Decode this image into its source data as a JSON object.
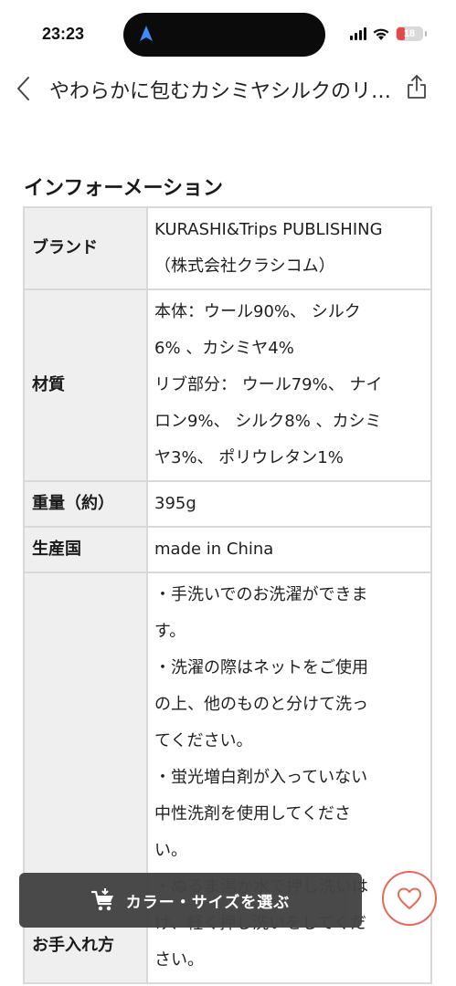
{
  "status_bar": {
    "time": "23:23",
    "battery_level": "18"
  },
  "header": {
    "title": "やわらかに包むカシミヤシルクのリブ編みニット",
    "back_icon": "chevron-left-icon",
    "share_icon": "share-icon"
  },
  "section": {
    "title": "インフォーメーション"
  },
  "info_table": {
    "brand_label": "ブランド",
    "brand_lines": [
      "KURASHI&Trips PUBLISHING",
      "（株式会社クラシコム）"
    ],
    "material_label": "材質",
    "material_lines": [
      "本体：ウール90%、 シルク",
      "6% 、カシミヤ4%",
      "リブ部分： ウール79%、 ナイ",
      "ロン9%、 シルク8% 、カシミ",
      "ヤ3%、 ポリウレタン1%"
    ],
    "weight_label": "重量（約）",
    "weight_value": "395g",
    "origin_label": "生産国",
    "origin_value": "made in China",
    "care_label": "お手入れ方",
    "care_lines": [
      "・手洗いでのお洗濯ができま",
      "す。",
      "・洗濯の際はネットをご使用",
      "の上、他のものと分けて洗っ",
      "てください。",
      "・蛍光増白剤が入っていない",
      "中性洗剤を使用してくださ",
      "い。",
      "・ぬるま湯か水で押し洗いは",
      "け、軽く押し洗いをしてくだ",
      "さい。"
    ]
  },
  "floating": {
    "select_label": "カラー・サイズを選ぶ",
    "cart_icon": "cart-icon",
    "heart_icon": "heart-icon",
    "accent_color": "#e46a5e",
    "button_color": "#444444"
  }
}
